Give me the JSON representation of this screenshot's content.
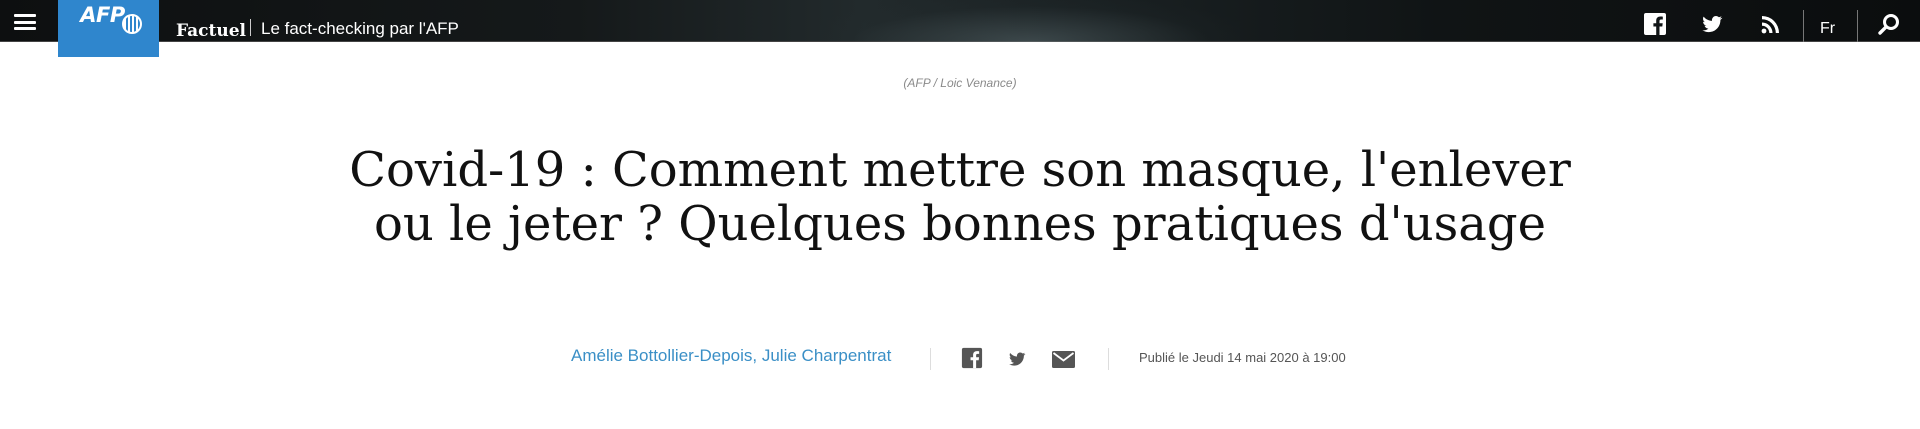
{
  "header": {
    "logo_text": "AFP",
    "section": "Factuel",
    "tagline": "Le fact-checking par l'AFP",
    "language": "Fr",
    "icons": [
      "menu-icon",
      "afp-logo",
      "facebook-icon",
      "twitter-icon",
      "rss-icon",
      "search-icon"
    ],
    "colors": {
      "logo_bg": "#2f86cd",
      "header_bg": "#111517"
    }
  },
  "photo_credit": "(AFP / Loic Venance)",
  "article": {
    "title_line1": "Covid-19 : Comment mettre son masque, l'enlever",
    "title_line2": "ou le jeter ? Quelques bonnes pratiques d'usage",
    "authors": "Amélie Bottollier-Depois, Julie Charpentrat",
    "share_icons": [
      "facebook-icon",
      "twitter-icon",
      "mail-icon"
    ],
    "published": "Publié le Jeudi 14 mai 2020 à 19:00",
    "colors": {
      "author_link": "#3a8fc6",
      "title": "#111111"
    }
  }
}
